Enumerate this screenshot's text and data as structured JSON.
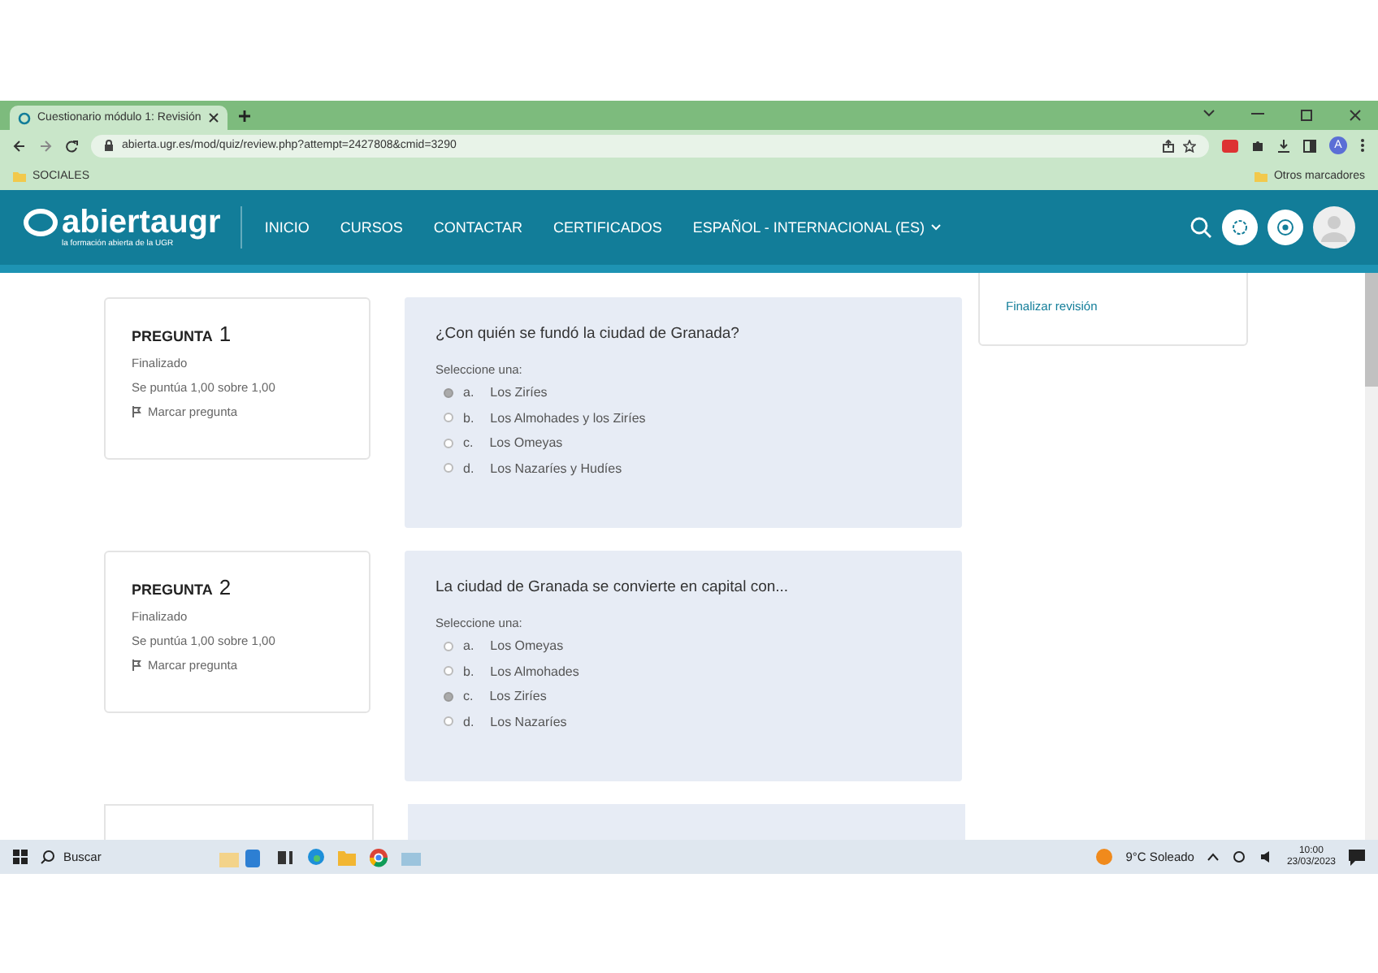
{
  "browser": {
    "tab_title": "Cuestionario módulo 1: Revisión",
    "url": "abierta.ugr.es/mod/quiz/review.php?attempt=2427808&cmid=3290",
    "bookmarks": [
      {
        "label": "SOCIALES"
      }
    ],
    "other_bookmarks": "Otros marcadores",
    "profile_initial": "A"
  },
  "site": {
    "logo_text": "abiertaugr",
    "logo_tagline": "la formación abierta de la UGR",
    "nav": [
      {
        "label": "INICIO"
      },
      {
        "label": "CURSOS"
      },
      {
        "label": "CONTACTAR"
      },
      {
        "label": "CERTIFICADOS"
      },
      {
        "label": "ESPAÑOL - INTERNACIONAL (ES)",
        "dropdown": true
      }
    ]
  },
  "sidebar": {
    "link": "Finalizar revisión"
  },
  "questions": [
    {
      "label": "PREGUNTA",
      "number": "1",
      "state": "Finalizado",
      "grade": "Se puntúa 1,00 sobre 1,00",
      "flag": "Marcar pregunta",
      "text": "¿Con quién se fundó la ciudad de Granada?",
      "prompt": "Seleccione una:",
      "options": [
        {
          "letter": "a.",
          "text": "Los Ziríes",
          "selected": true
        },
        {
          "letter": "b.",
          "text": "Los Almohades y los Ziríes",
          "selected": false
        },
        {
          "letter": "c.",
          "text": "Los Omeyas",
          "selected": false
        },
        {
          "letter": "d.",
          "text": "Los Nazaríes y Hudíes",
          "selected": false
        }
      ]
    },
    {
      "label": "PREGUNTA",
      "number": "2",
      "state": "Finalizado",
      "grade": "Se puntúa 1,00 sobre 1,00",
      "flag": "Marcar pregunta",
      "text": "La ciudad de Granada se convierte en capital con...",
      "prompt": "Seleccione una:",
      "options": [
        {
          "letter": "a.",
          "text": "Los Omeyas",
          "selected": false
        },
        {
          "letter": "b.",
          "text": "Los Almohades",
          "selected": false
        },
        {
          "letter": "c.",
          "text": "Los Ziríes",
          "selected": true
        },
        {
          "letter": "d.",
          "text": "Los Nazaríes",
          "selected": false
        }
      ]
    }
  ],
  "taskbar": {
    "search": "Buscar",
    "weather": "9°C Soleado",
    "time": "10:00",
    "date": "23/03/2023"
  }
}
